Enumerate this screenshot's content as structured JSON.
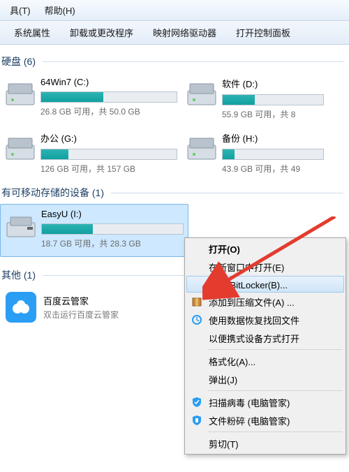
{
  "menubar": {
    "tools": "具(T)",
    "help": "帮助(H)"
  },
  "toolbar": {
    "sys_props": "系统属性",
    "uninstall": "卸载或更改程序",
    "map_drive": "映射网络驱动器",
    "control_panel": "打开控制面板"
  },
  "sections": {
    "hdd": "硬盘 (6)",
    "removable": "有可移动存储的设备 (1)",
    "other": "其他 (1)"
  },
  "drives": {
    "c": {
      "name": "64Win7  (C:)",
      "sub": "26.8 GB 可用，共 50.0 GB",
      "fill": 46
    },
    "d": {
      "name": "软件 (D:)",
      "sub": "55.9 GB 可用，共 8",
      "fill": 32
    },
    "g": {
      "name": "办公 (G:)",
      "sub": "126 GB 可用，共 157 GB",
      "fill": 20
    },
    "h": {
      "name": "备份 (H:)",
      "sub": "43.9 GB 可用，共 49",
      "fill": 12
    },
    "i": {
      "name": "EasyU   (I:)",
      "sub": "18.7 GB 可用，共 28.3 GB",
      "fill": 36
    }
  },
  "app": {
    "name": "百度云管家",
    "sub": "双击运行百度云管家"
  },
  "context_menu": {
    "open": "打开(O)",
    "open_new": "在新窗口中打开(E)",
    "bitlocker": "启用 BitLocker(B)...",
    "add_zip": "添加到压缩文件(A) ...",
    "recover": "使用数据恢复找回文件",
    "portable": "以便携式设备方式打开",
    "format": "格式化(A)...",
    "eject": "弹出(J)",
    "scan_virus": "扫描病毒 (电脑管家)",
    "shred": "文件粉碎 (电脑管家)",
    "cut": "剪切(T)"
  }
}
